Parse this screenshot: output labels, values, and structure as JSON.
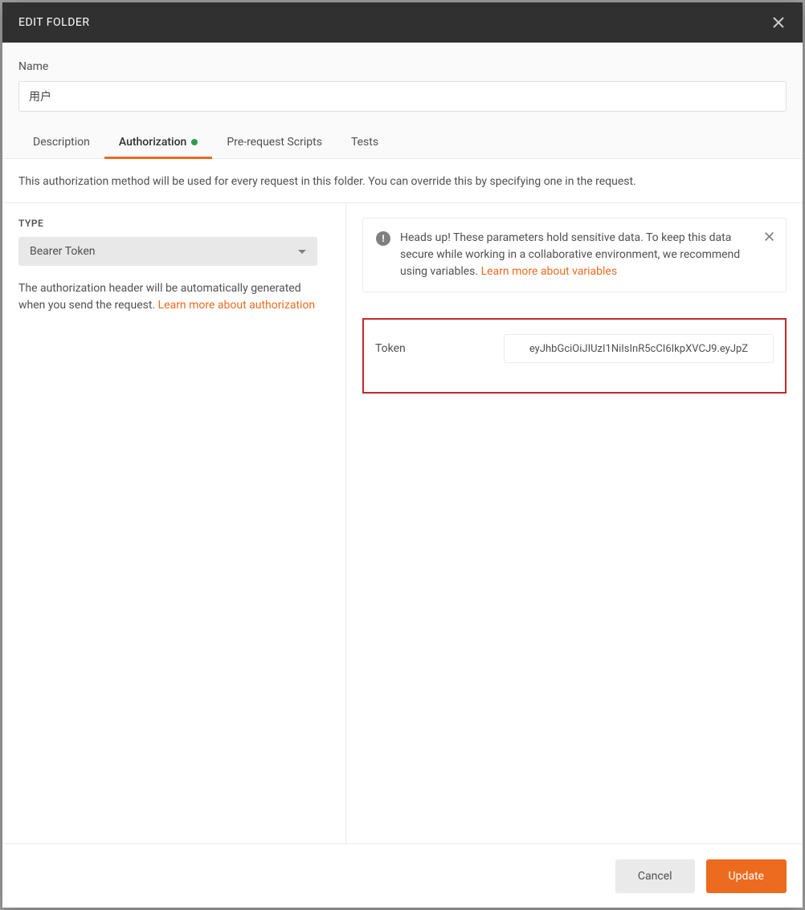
{
  "modal": {
    "title": "EDIT FOLDER"
  },
  "name": {
    "label": "Name",
    "value": "用户"
  },
  "tabs": {
    "description": "Description",
    "authorization": "Authorization",
    "prerequest": "Pre-request Scripts",
    "tests": "Tests"
  },
  "auth": {
    "description": "This authorization method will be used for every request in this folder. You can override this by specifying one in the request.",
    "type_label": "TYPE",
    "type_value": "Bearer Token",
    "help_text_1": "The authorization header will be automatically generated when you send the request. ",
    "help_link": "Learn more about authorization",
    "info_text": "Heads up! These parameters hold sensitive data. To keep this data secure while working in a collaborative environment, we recommend using variables. ",
    "info_link": "Learn more about variables",
    "token_label": "Token",
    "token_value": "eyJhbGciOiJIUzI1NiIsInR5cCI6IkpXVCJ9.eyJpZ"
  },
  "footer": {
    "cancel": "Cancel",
    "update": "Update"
  }
}
